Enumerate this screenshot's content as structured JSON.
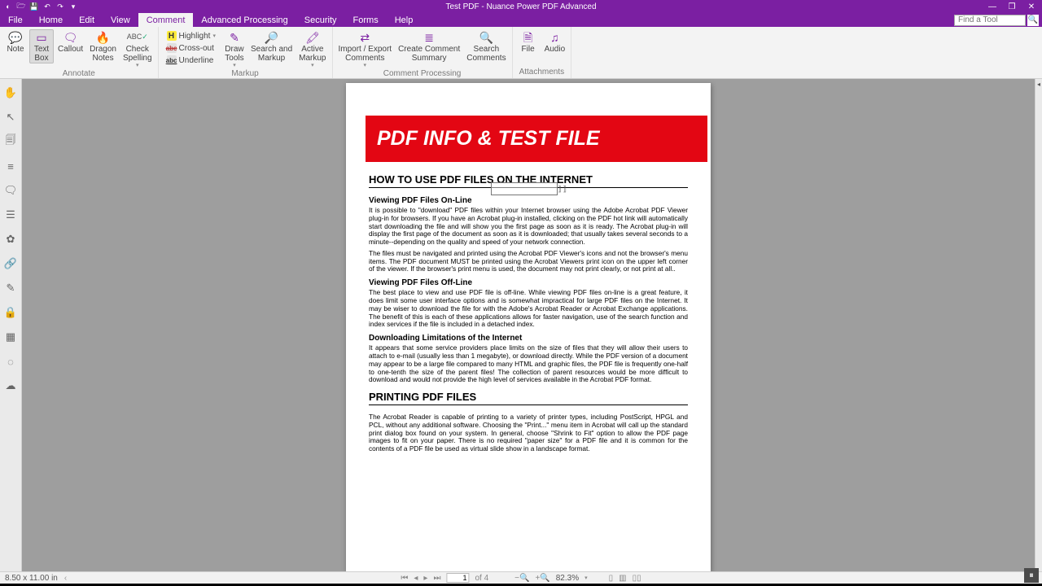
{
  "app": {
    "title": "Test PDF - Nuance Power PDF Advanced"
  },
  "menubar": {
    "tabs": [
      "File",
      "Home",
      "Edit",
      "View",
      "Comment",
      "Advanced Processing",
      "Security",
      "Forms",
      "Help"
    ],
    "active": "Comment",
    "find_placeholder": "Find a Tool"
  },
  "ribbon": {
    "annotate": {
      "name": "Annotate",
      "note": "Note",
      "textbox": "Text\nBox",
      "callout": "Callout",
      "dragon": "Dragon\nNotes",
      "spell": "Check\nSpelling"
    },
    "markup": {
      "name": "Markup",
      "highlight": "Highlight",
      "crossout": "Cross-out",
      "underline": "Underline",
      "draw": "Draw\nTools",
      "sam": "Search and\nMarkup",
      "active": "Active\nMarkup"
    },
    "cproc": {
      "name": "Comment Processing",
      "impexp": "Import / Export\nComments",
      "summary": "Create Comment\nSummary",
      "search": "Search\nComments"
    },
    "attach": {
      "name": "Attachments",
      "file": "File",
      "audio": "Audio"
    }
  },
  "doc": {
    "banner": "PDF INFO & TEST FILE",
    "h_internet": "HOW TO USE PDF FILES ON THE INTERNET",
    "h_online": "Viewing PDF Files On-Line",
    "p_online1": "It is possible to \"download\" PDF files within your Internet browser using the Adobe Acrobat PDF Viewer plug-in for browsers. If you have an Acrobat plug-in installed, clicking on the PDF hot link will automatically start downloading the file and will show you the first page as soon as it is ready. The Acrobat plug-in will display the first page of the document as soon as it is downloaded; that usually takes several seconds to a minute--depending on the quality and speed of your network connection.",
    "p_online2": "The files must be navigated and printed using the Acrobat PDF Viewer's icons and not the browser's menu items. The PDF document MUST be printed using the Acrobat Viewers print icon on the upper left corner of the viewer. If the browser's print menu is used, the document may not print clearly, or not print at all..",
    "h_offline": "Viewing PDF Files Off-Line",
    "p_offline": "The best place to view and use PDF file is off-line. While viewing PDF files on-line is a great feature, it does limit some user interface options and is somewhat impractical for large PDF files on the Internet. It may be wiser to download the file for with the Adobe's Acrobat Reader or Acrobat Exchange applications. The benefit of this is each of these applications allows for faster navigation, use of the search function and index services if the file is included in a detached index.",
    "h_dl": "Downloading Limitations of the Internet",
    "p_dl": "It appears that some service providers place limits on the size of files that they will allow their users to attach to e-mail (usually less than 1 megabyte), or download directly. While the PDF version of a document may appear to be a large file compared to many HTML and graphic files, the PDF file is frequently one-half to one-tenth the size of the parent files! The collection of parent resources would be more difficult to download and would not provide the high level of services available in the Acrobat PDF format.",
    "h_print": "PRINTING PDF FILES",
    "p_print": "The Acrobat Reader is capable of printing to a variety of printer types, including PostScript, HPGL and PCL, without any additional software. Choosing the \"Print...\" menu item in Acrobat will call up the standard print dialog box found on your system. In general, choose \"Shrink to Fit\" option to allow the PDF page images to fit on your paper. There is no required \"paper size\" for a PDF file and it is common for the contents of a PDF file be used as virtual slide show in a landscape format."
  },
  "status": {
    "pagesize": "8.50 x 11.00 in",
    "page_current": "1",
    "page_total": "of 4",
    "zoom": "82.3%"
  }
}
